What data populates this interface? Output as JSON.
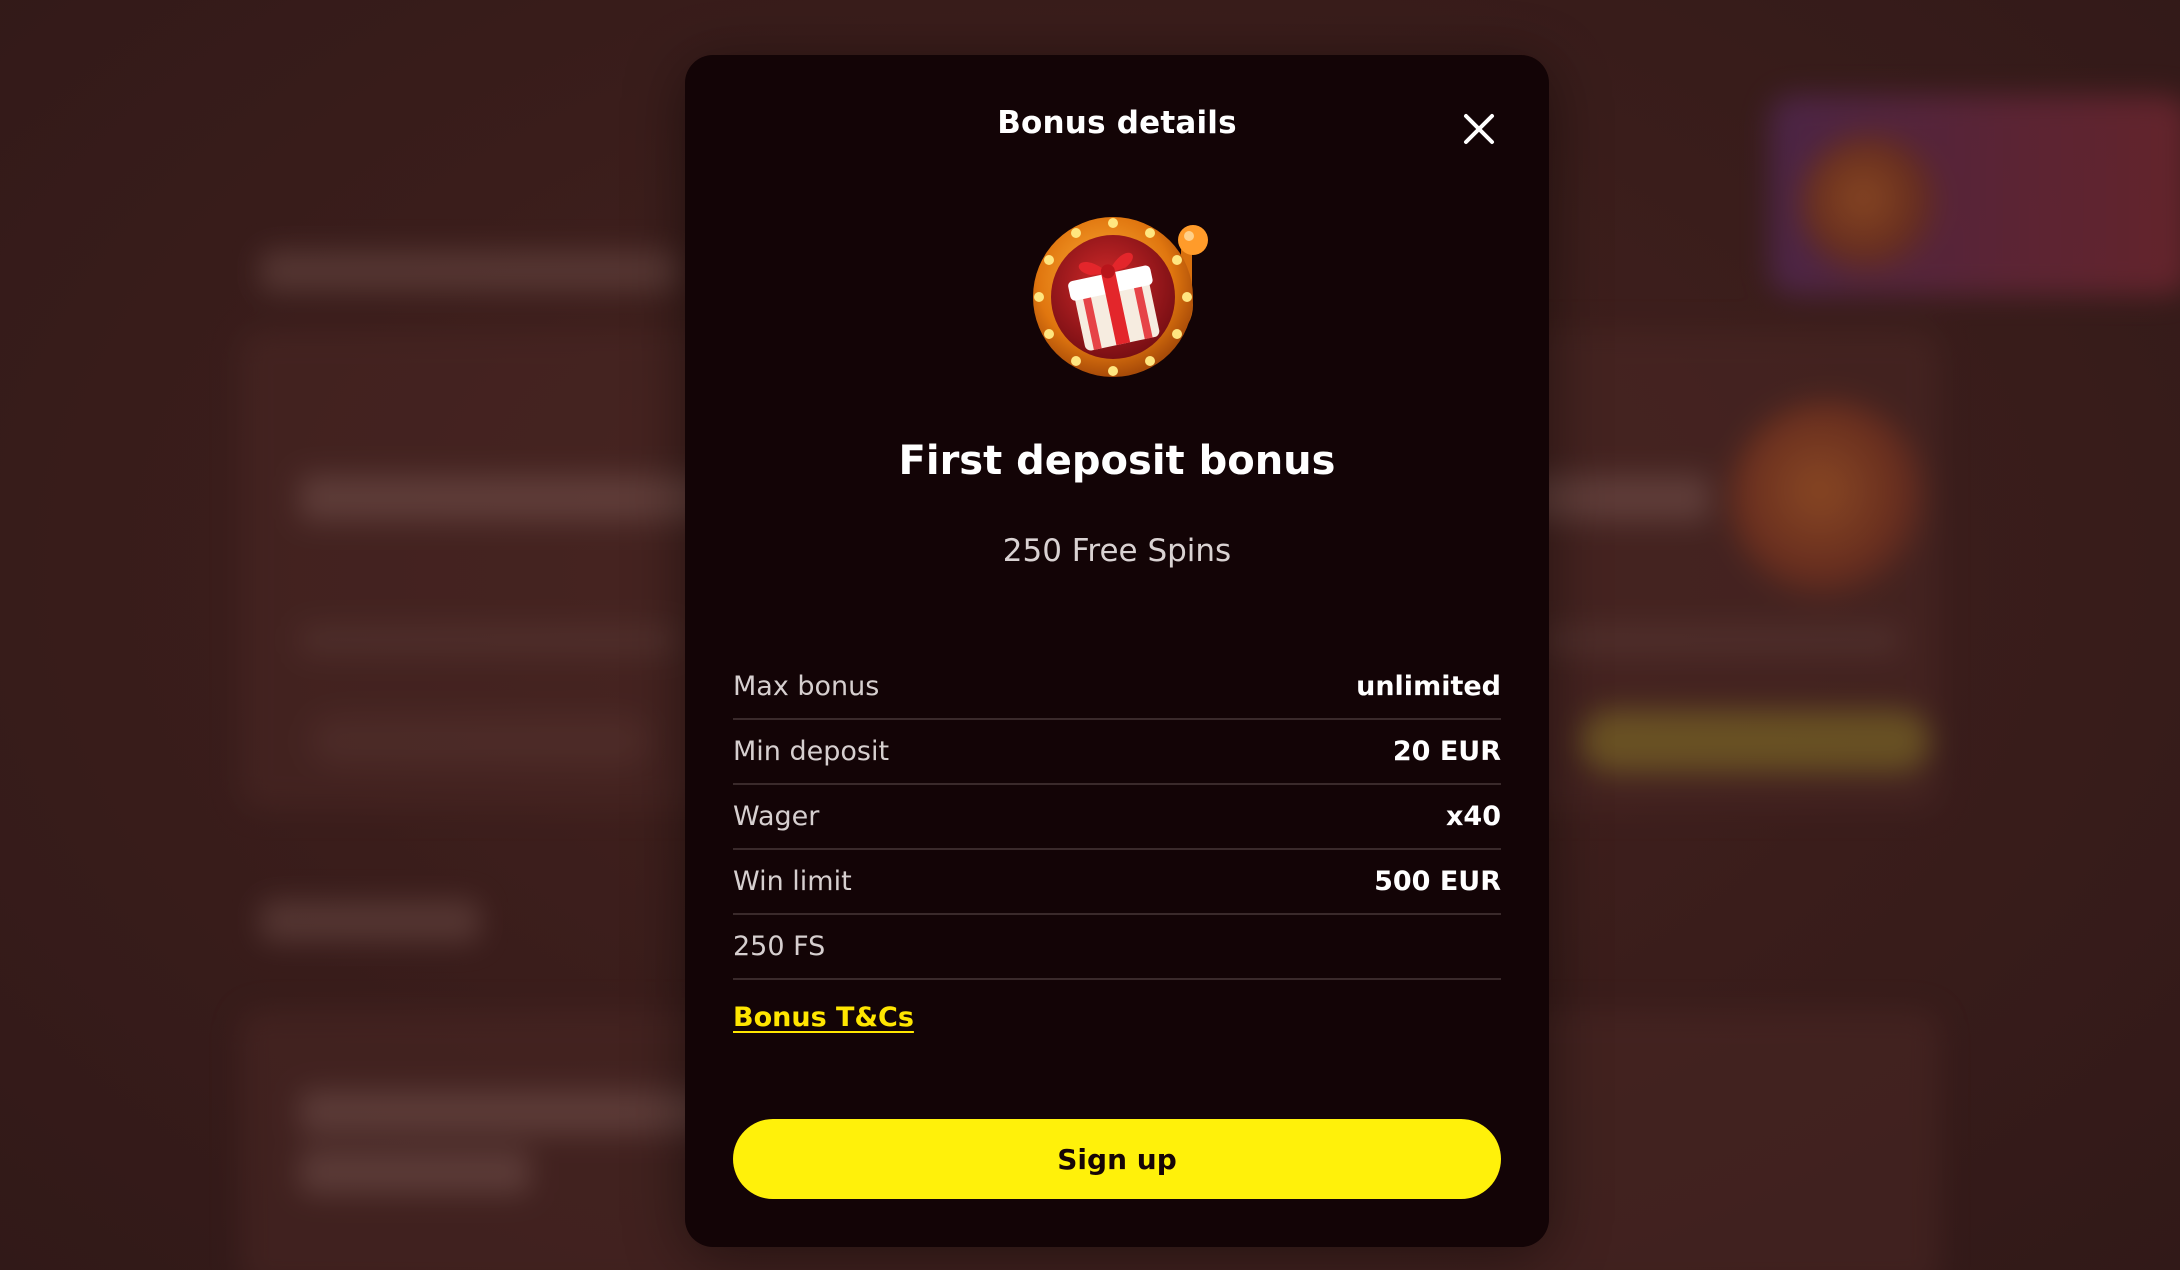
{
  "modal": {
    "title": "Bonus details",
    "close_icon": "close-icon",
    "bonus_icon": "gift-slot-wheel-icon",
    "bonus_name": "First deposit bonus",
    "bonus_subtitle": "250 Free Spins",
    "details": [
      {
        "label": "Max bonus",
        "value": "unlimited"
      },
      {
        "label": "Min deposit",
        "value": "20 EUR"
      },
      {
        "label": "Wager",
        "value": "x40"
      },
      {
        "label": "Win limit",
        "value": "500 EUR"
      },
      {
        "label": "250 FS",
        "value": ""
      }
    ],
    "terms_link": "Bonus T&Cs",
    "signup_label": "Sign up"
  },
  "colors": {
    "modal_bg": "#130406",
    "backdrop": "#3a1d1b",
    "accent_yellow": "#fff10a",
    "link_yellow": "#ffe600"
  }
}
